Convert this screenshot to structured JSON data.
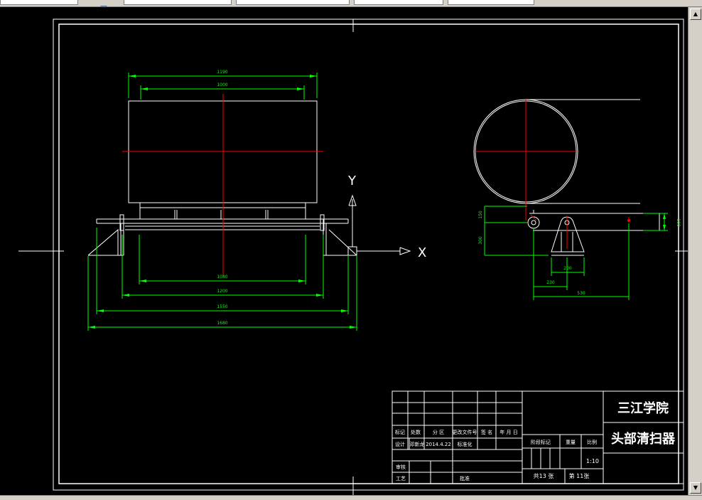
{
  "toolbar": {
    "fields": [
      "",
      "",
      "",
      "",
      "",
      "",
      ""
    ],
    "icons": [
      "layer-icon",
      "properties-icon"
    ]
  },
  "drawing": {
    "colors": {
      "background": "#000000",
      "geometry": "#ffffff",
      "dimension": "#00ff00",
      "centerline": "#ff0000"
    },
    "dims_front": {
      "top_outer": "1190",
      "top_inner": "1000",
      "bottom_1": "1080",
      "bottom_2": "1200",
      "bottom_3": "1550",
      "bottom_4": "1680"
    },
    "dims_side": {
      "v1": "150",
      "v2": "300",
      "v3": "100",
      "h1": "200",
      "h2": "230",
      "h3": "530"
    },
    "ucs": {
      "x_label": "X",
      "y_label": "Y"
    }
  },
  "title_block": {
    "school": "三江学院",
    "drawing_name": "头部清扫器",
    "row_labels": [
      "标记",
      "处数",
      "分 区",
      "更改文件号",
      "签 名",
      "年 月 日"
    ],
    "design_row": [
      "设计",
      "邓新龙",
      "2014.4.22",
      "标准化"
    ],
    "review": "审核",
    "process": "工艺",
    "approve": "批准",
    "stage_label": "阶段标记",
    "weight_label": "重量",
    "scale_label": "比例",
    "scale": "1:10",
    "sheet_total": "共13 张",
    "sheet_no": "第 11张"
  }
}
